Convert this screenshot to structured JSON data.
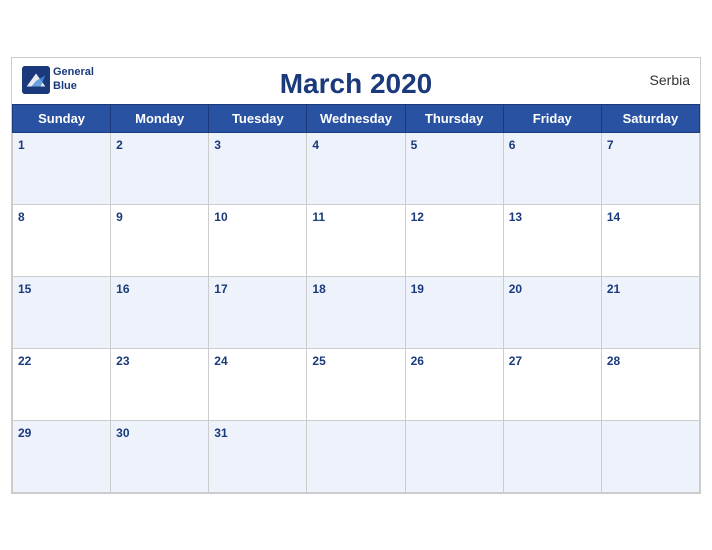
{
  "header": {
    "title": "March 2020",
    "country": "Serbia",
    "logo_line1": "General",
    "logo_line2": "Blue"
  },
  "weekdays": [
    "Sunday",
    "Monday",
    "Tuesday",
    "Wednesday",
    "Thursday",
    "Friday",
    "Saturday"
  ],
  "weeks": [
    [
      {
        "date": 1,
        "empty": false
      },
      {
        "date": 2,
        "empty": false
      },
      {
        "date": 3,
        "empty": false
      },
      {
        "date": 4,
        "empty": false
      },
      {
        "date": 5,
        "empty": false
      },
      {
        "date": 6,
        "empty": false
      },
      {
        "date": 7,
        "empty": false
      }
    ],
    [
      {
        "date": 8,
        "empty": false
      },
      {
        "date": 9,
        "empty": false
      },
      {
        "date": 10,
        "empty": false
      },
      {
        "date": 11,
        "empty": false
      },
      {
        "date": 12,
        "empty": false
      },
      {
        "date": 13,
        "empty": false
      },
      {
        "date": 14,
        "empty": false
      }
    ],
    [
      {
        "date": 15,
        "empty": false
      },
      {
        "date": 16,
        "empty": false
      },
      {
        "date": 17,
        "empty": false
      },
      {
        "date": 18,
        "empty": false
      },
      {
        "date": 19,
        "empty": false
      },
      {
        "date": 20,
        "empty": false
      },
      {
        "date": 21,
        "empty": false
      }
    ],
    [
      {
        "date": 22,
        "empty": false
      },
      {
        "date": 23,
        "empty": false
      },
      {
        "date": 24,
        "empty": false
      },
      {
        "date": 25,
        "empty": false
      },
      {
        "date": 26,
        "empty": false
      },
      {
        "date": 27,
        "empty": false
      },
      {
        "date": 28,
        "empty": false
      }
    ],
    [
      {
        "date": 29,
        "empty": false
      },
      {
        "date": 30,
        "empty": false
      },
      {
        "date": 31,
        "empty": false
      },
      {
        "date": null,
        "empty": true
      },
      {
        "date": null,
        "empty": true
      },
      {
        "date": null,
        "empty": true
      },
      {
        "date": null,
        "empty": true
      }
    ]
  ]
}
